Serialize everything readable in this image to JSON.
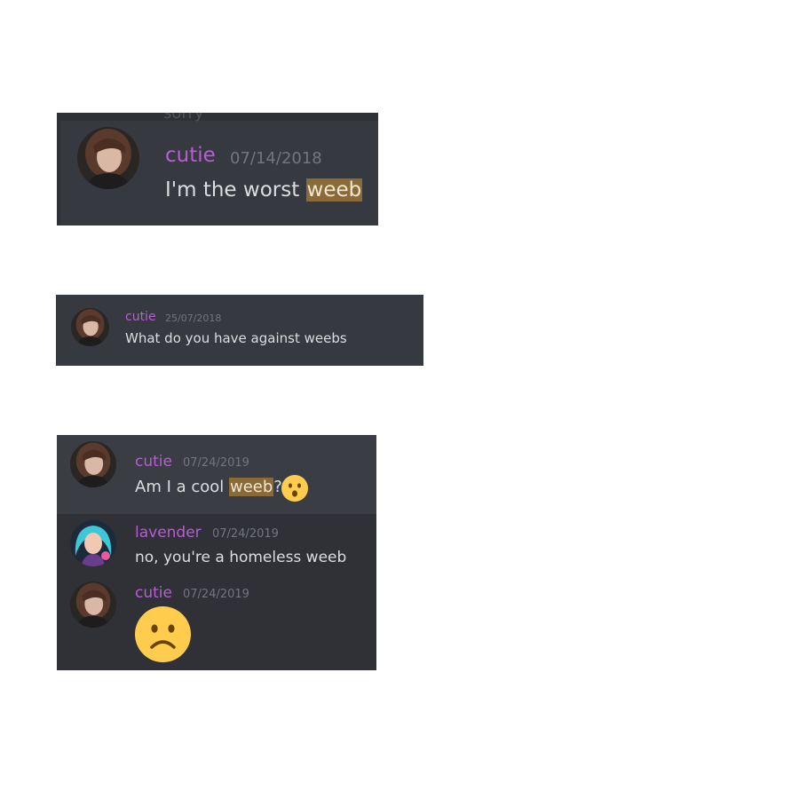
{
  "panels": [
    {
      "messages": [
        {
          "author": "cutie",
          "timestamp": "07/14/2018",
          "text_before": "I'm the worst ",
          "highlight": "weeb"
        }
      ],
      "cut_off_text": "sorry"
    },
    {
      "messages": [
        {
          "author": "cutie",
          "timestamp": "25/07/2018",
          "text": "What do you have against weebs"
        }
      ]
    },
    {
      "messages": [
        {
          "author": "cutie",
          "timestamp": "07/24/2019",
          "text_before": "Am I a cool ",
          "highlight": "weeb",
          "text_after": "?",
          "emoji": "hushed-face"
        },
        {
          "author": "lavender",
          "timestamp": "07/24/2019",
          "text": "no, you're a homeless weeb"
        },
        {
          "author": "cutie",
          "timestamp": "07/24/2019",
          "emoji": "frowning-face"
        }
      ]
    }
  ],
  "colors": {
    "username": "#b55fd2",
    "timestamp": "#72767d",
    "message_text": "#dcddde",
    "highlight_bg": "#8a6a36",
    "background_dark": "#2f3136",
    "background_main": "#36393f",
    "emoji_yellow": "#ffcc4d"
  }
}
